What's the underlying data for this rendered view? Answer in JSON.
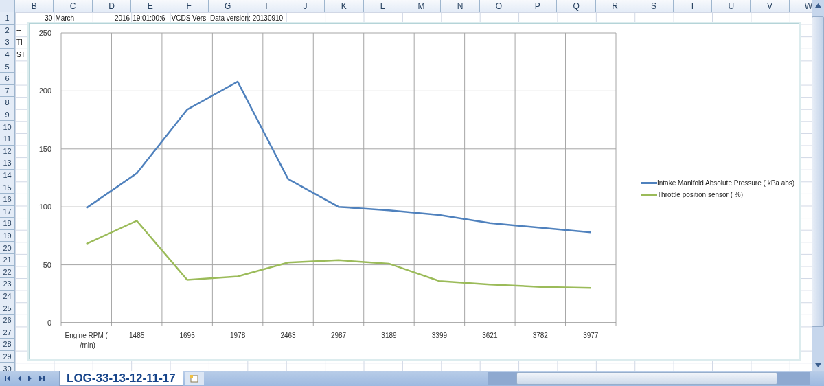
{
  "columns": [
    "B",
    "C",
    "D",
    "E",
    "F",
    "G",
    "I",
    "J",
    "K",
    "L",
    "M",
    "N",
    "O",
    "P",
    "Q",
    "R",
    "S",
    "T",
    "U",
    "V",
    "W"
  ],
  "rows": [
    "1",
    "2",
    "3",
    "4",
    "5",
    "6",
    "7",
    "8",
    "9",
    "10",
    "11",
    "12",
    "13",
    "14",
    "15",
    "16",
    "17",
    "18",
    "19",
    "20",
    "21",
    "22",
    "23",
    "24",
    "25",
    "26",
    "27",
    "28",
    "29",
    "30"
  ],
  "cells": [
    [
      {
        "text": "30",
        "kind": "number"
      },
      {
        "text": "March",
        "kind": "text"
      },
      {
        "text": "2016",
        "kind": "number"
      },
      {
        "text": "19:01:00:6",
        "kind": "text"
      },
      {
        "text": "VCDS Vers",
        "kind": "text"
      },
      {
        "text": "Data version: 20130910",
        "kind": "text"
      }
    ],
    [
      {
        "text": "--",
        "kind": "text"
      }
    ],
    [
      {
        "text": "TI",
        "kind": "text"
      }
    ],
    [
      {
        "text": "ST",
        "kind": "text"
      }
    ]
  ],
  "chart": {
    "chart_data": {
      "type": "line",
      "grid": true,
      "categories": [
        "Engine RPM ( /min)",
        "1485",
        "1695",
        "1978",
        "2463",
        "2987",
        "3189",
        "3399",
        "3621",
        "3782",
        "3977"
      ],
      "ylim": [
        0,
        250
      ],
      "yticks": [
        0,
        50,
        100,
        150,
        200,
        250
      ],
      "series": [
        {
          "name": "Intake Manifold Absolute Pressure ( kPa abs)",
          "color": "#4f81bd",
          "values": [
            99,
            129,
            184,
            208,
            124,
            100,
            97,
            93,
            86,
            82,
            78
          ]
        },
        {
          "name": "Throttle position sensor ( %)",
          "color": "#9bbb59",
          "values": [
            68,
            88,
            37,
            40,
            52,
            54,
            51,
            36,
            33,
            31,
            30
          ]
        }
      ]
    }
  },
  "sheet_tabs": [
    {
      "label": "LOG-33-13-12-11-17",
      "selected": true
    }
  ]
}
